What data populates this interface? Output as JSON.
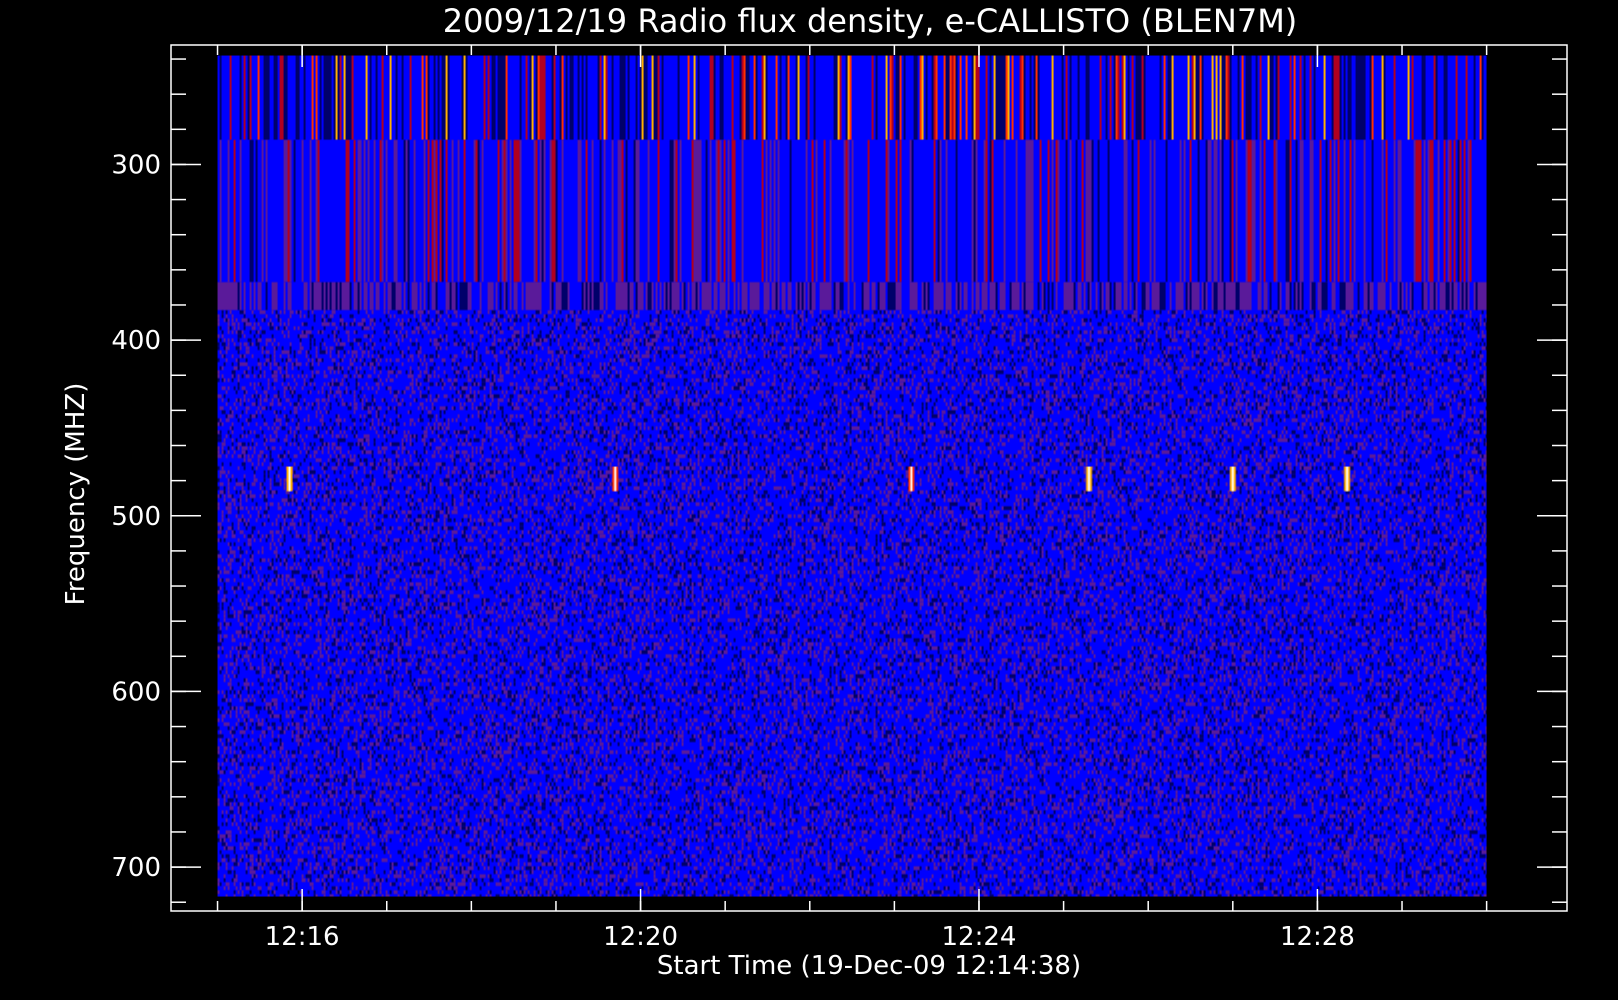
{
  "chart_data": {
    "type": "heatmap",
    "title": "2009/12/19  Radio flux density, e-CALLISTO (BLEN7M)",
    "xlabel": "Start Time (19-Dec-09 12:14:38)",
    "ylabel": "Frequency (MHZ)",
    "x_ticks": [
      {
        "label": "12:16",
        "value_min": 16
      },
      {
        "label": "12:20",
        "value_min": 20
      },
      {
        "label": "12:24",
        "value_min": 24
      },
      {
        "label": "12:28",
        "value_min": 28
      }
    ],
    "y_ticks": [
      {
        "label": "300",
        "value": 300
      },
      {
        "label": "400",
        "value": 400
      },
      {
        "label": "500",
        "value": 500
      },
      {
        "label": "600",
        "value": 600
      },
      {
        "label": "700",
        "value": 700
      }
    ],
    "xlim_min": [
      14.45,
      30.95
    ],
    "ylim_mhz": [
      725,
      232
    ],
    "data_xrange_min": [
      15.0,
      30.0
    ],
    "data_yrange_mhz": [
      238,
      717
    ],
    "colormap": [
      "#00006a",
      "#0000ff",
      "#5a1a9a",
      "#b00020",
      "#ff3000",
      "#ffb000",
      "#ffffff"
    ],
    "frame_color": "#ffffff",
    "background_color": "#000000",
    "freq_bands_mhz": [
      {
        "range": [
          238,
          286
        ],
        "level": "high"
      },
      {
        "range": [
          286,
          367
        ],
        "level": "medium"
      },
      {
        "range": [
          367,
          383
        ],
        "level": "purple"
      },
      {
        "range": [
          383,
          717
        ],
        "level": "low"
      }
    ],
    "bursts": [
      {
        "t_min": 15.85,
        "f_mhz": [
          472,
          486
        ],
        "intensity": "strong"
      },
      {
        "t_min": 19.7,
        "f_mhz": [
          472,
          486
        ],
        "intensity": "medium"
      },
      {
        "t_min": 23.2,
        "f_mhz": [
          472,
          486
        ],
        "intensity": "medium"
      },
      {
        "t_min": 25.3,
        "f_mhz": [
          472,
          486
        ],
        "intensity": "strong"
      },
      {
        "t_min": 27.0,
        "f_mhz": [
          472,
          486
        ],
        "intensity": "strong"
      },
      {
        "t_min": 28.35,
        "f_mhz": [
          472,
          486
        ],
        "intensity": "strong"
      }
    ]
  }
}
